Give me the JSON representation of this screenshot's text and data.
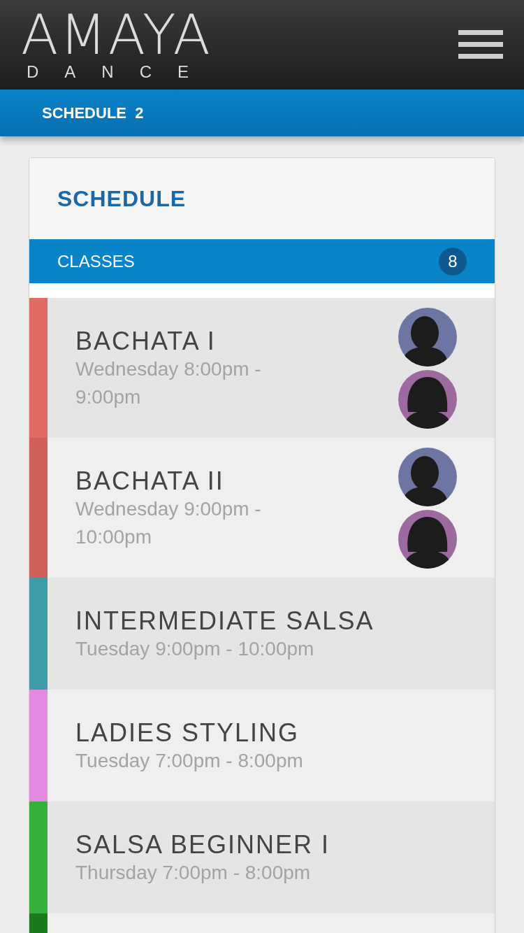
{
  "header": {
    "logo_title": "AMAYA",
    "logo_subtitle": "DANCE"
  },
  "breadcrumb": "SCHEDULE  2",
  "card": {
    "title": "SCHEDULE",
    "section": {
      "label": "CLASSES",
      "count": "8"
    },
    "classes": [
      {
        "name": "BACHATA I",
        "time": "Wednesday  8:00pm - 9:00pm",
        "color": "#e06b65",
        "instructors": [
          {
            "kind": "male"
          },
          {
            "kind": "female"
          }
        ]
      },
      {
        "name": "BACHATA II",
        "time": "Wednesday  9:00pm - 10:00pm",
        "color": "#cf5f59",
        "instructors": [
          {
            "kind": "male"
          },
          {
            "kind": "female"
          }
        ]
      },
      {
        "name": "INTERMEDIATE SALSA",
        "time": "Tuesday  9:00pm - 10:00pm",
        "color": "#3f9ba6"
      },
      {
        "name": "LADIES STYLING",
        "time": "Tuesday  7:00pm - 8:00pm",
        "color": "#e38ae0"
      },
      {
        "name": "SALSA BEGINNER I",
        "time": "Thursday  7:00pm - 8:00pm",
        "color": "#34b03b"
      },
      {
        "color": "#1b7a1e"
      }
    ]
  }
}
